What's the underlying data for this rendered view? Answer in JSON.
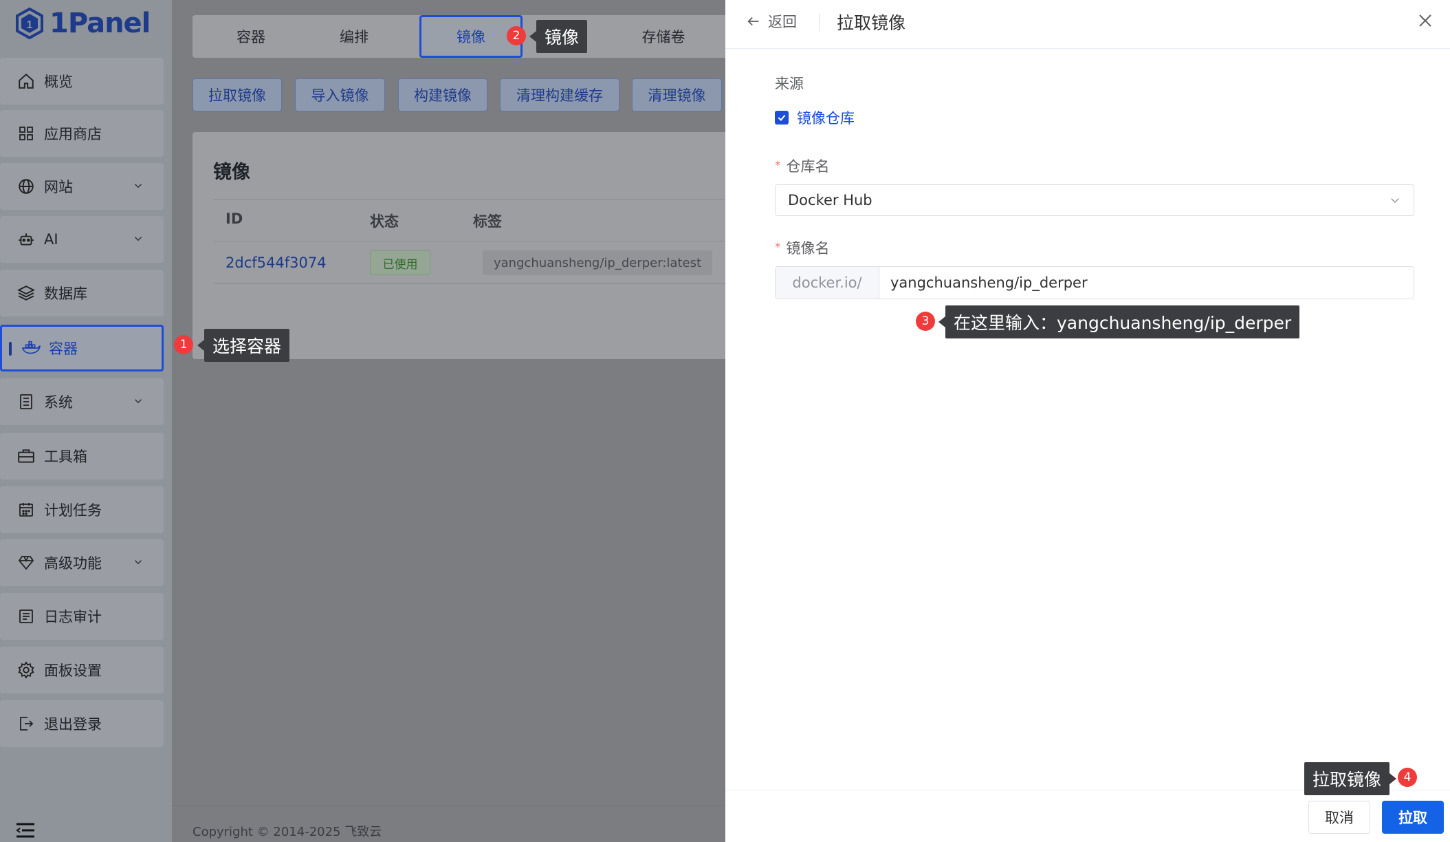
{
  "app": {
    "logo_text": "1Panel"
  },
  "sidebar": {
    "items": [
      {
        "label": "概览",
        "icon": "home-icon",
        "chevron": false
      },
      {
        "label": "应用商店",
        "icon": "grid-icon",
        "chevron": false
      },
      {
        "label": "网站",
        "icon": "globe-icon",
        "chevron": true
      },
      {
        "label": "AI",
        "icon": "robot-icon",
        "chevron": true
      },
      {
        "label": "数据库",
        "icon": "layers-icon",
        "chevron": false
      },
      {
        "label": "容器",
        "icon": "docker-icon",
        "chevron": false,
        "active": true
      },
      {
        "label": "系统",
        "icon": "server-icon",
        "chevron": true
      },
      {
        "label": "工具箱",
        "icon": "toolbox-icon",
        "chevron": false
      },
      {
        "label": "计划任务",
        "icon": "calendar-icon",
        "chevron": false
      },
      {
        "label": "高级功能",
        "icon": "diamond-icon",
        "chevron": true
      },
      {
        "label": "日志审计",
        "icon": "log-icon",
        "chevron": false
      },
      {
        "label": "面板设置",
        "icon": "gear-icon",
        "chevron": false
      },
      {
        "label": "退出登录",
        "icon": "logout-icon",
        "chevron": false
      }
    ]
  },
  "tabs": [
    {
      "label": "容器"
    },
    {
      "label": "编排"
    },
    {
      "label": "镜像",
      "active": true
    },
    {
      "label": "存储卷"
    }
  ],
  "actions": [
    {
      "label": "拉取镜像"
    },
    {
      "label": "导入镜像"
    },
    {
      "label": "构建镜像"
    },
    {
      "label": "清理构建缓存"
    },
    {
      "label": "清理镜像"
    }
  ],
  "images_card": {
    "title": "镜像",
    "columns": [
      "ID",
      "状态",
      "标签"
    ],
    "rows": [
      {
        "id": "2dcf544f3074",
        "status": "已使用",
        "tag": "yangchuansheng/ip_derper:latest"
      }
    ]
  },
  "footer": {
    "copyright": "Copyright © 2014-2025 飞致云"
  },
  "drawer": {
    "back_label": "返回",
    "title": "拉取镜像",
    "source_label": "来源",
    "source_option": "镜像仓库",
    "repo_label": "仓库名",
    "repo_value": "Docker Hub",
    "image_label": "镜像名",
    "image_prefix": "docker.io/",
    "image_value": "yangchuansheng/ip_derper",
    "cancel_label": "取消",
    "submit_label": "拉取"
  },
  "annotations": [
    {
      "number": "1",
      "text": "选择容器"
    },
    {
      "number": "2",
      "text": "镜像"
    },
    {
      "number": "3",
      "text": "在这里输入：yangchuansheng/ip_derper"
    },
    {
      "number": "4",
      "text": "拉取镜像"
    }
  ],
  "colors": {
    "accent": "#1462e6",
    "marker": "#ef3b3b",
    "callout": "#3b3d40"
  }
}
